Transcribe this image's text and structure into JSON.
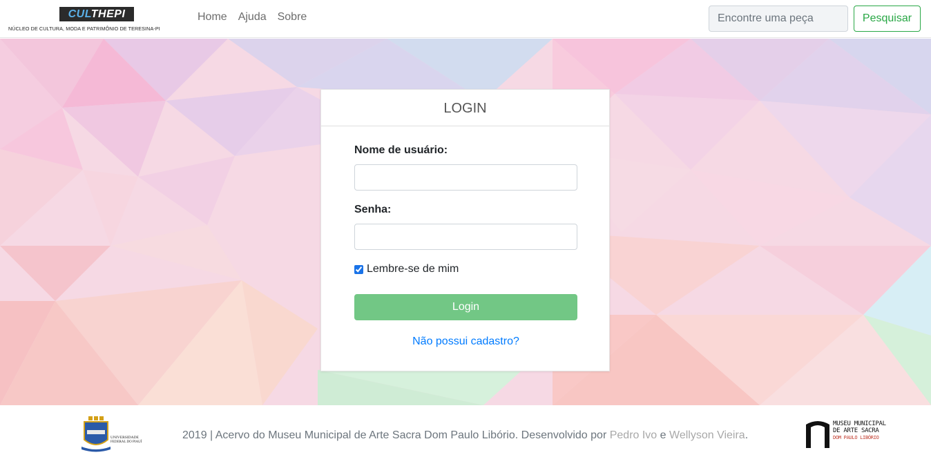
{
  "brand": {
    "logo_part1": "CUL",
    "logo_part2": "THEPI",
    "subtitle": "NÚCLEO DE CULTURA, MODA E PATRIMÔNIO DE TERESINA-PI"
  },
  "nav": {
    "links": [
      "Home",
      "Ajuda",
      "Sobre"
    ]
  },
  "search": {
    "placeholder": "Encontre uma peça",
    "button_label": "Pesquisar"
  },
  "login": {
    "title": "LOGIN",
    "username_label": "Nome de usuário:",
    "username_value": "",
    "password_label": "Senha:",
    "password_value": "",
    "remember_label": "Lembre-se de mim",
    "remember_checked": true,
    "submit_label": "Login",
    "register_link": "Não possui cadastro?"
  },
  "footer": {
    "text_prefix": "2019 | Acervo do Museu Municipal de Arte Sacra Dom Paulo Libório. Desenvolvido por ",
    "author1": "Pedro Ivo",
    "connector": " e ",
    "author2": "Wellyson Vieira",
    "suffix": ".",
    "ufpi_logo_text_line1": "UNIVERSIDADE",
    "ufpi_logo_text_line2": "FEDERAL DO PIAUÍ",
    "museu_logo_line1": "MUSEU MUNICIPAL",
    "museu_logo_line2": "DE ARTE SACRA",
    "museu_logo_line3": "DOM PAULO LIBÓRIO"
  },
  "colors": {
    "accent_green": "#28a745",
    "login_button": "#72c785",
    "link_blue": "#007bff"
  }
}
